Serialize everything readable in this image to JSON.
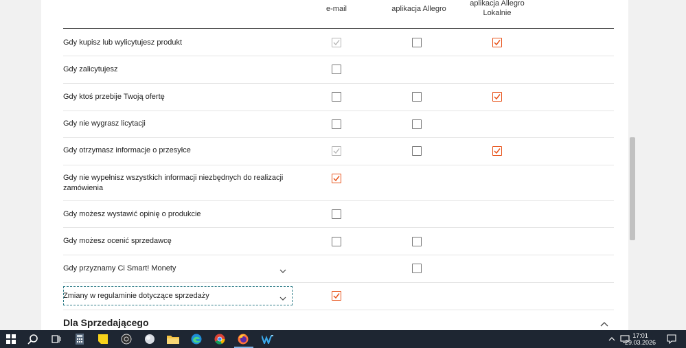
{
  "columns": {
    "email": "e-mail",
    "app": "aplikacja Allegro",
    "lokalnie": "aplikacja Allegro Lokalnie"
  },
  "rows": [
    {
      "label": "Gdy kupisz lub wylicytujesz produkt",
      "email": "checked-disabled",
      "app": "unchecked",
      "lokalnie": "checked"
    },
    {
      "label": "Gdy zalicytujesz",
      "email": "unchecked",
      "app": "",
      "lokalnie": ""
    },
    {
      "label": "Gdy ktoś przebije Twoją ofertę",
      "email": "unchecked",
      "app": "unchecked",
      "lokalnie": "checked"
    },
    {
      "label": "Gdy nie wygrasz licytacji",
      "email": "unchecked",
      "app": "unchecked",
      "lokalnie": ""
    },
    {
      "label": "Gdy otrzymasz informacje o przesyłce",
      "email": "checked-disabled",
      "app": "unchecked",
      "lokalnie": "checked"
    },
    {
      "label_line1": "Gdy nie wypełnisz wszystkich informacji niezbędnych do realizacji",
      "label_line2": "zamówienia",
      "email": "checked",
      "app": "",
      "lokalnie": ""
    },
    {
      "label": "Gdy możesz wystawić opinię o produkcie",
      "email": "unchecked",
      "app": "",
      "lokalnie": ""
    },
    {
      "label": "Gdy możesz ocenić sprzedawcę",
      "email": "unchecked",
      "app": "unchecked",
      "lokalnie": ""
    },
    {
      "label": "Gdy przyznamy Ci Smart! Monety",
      "email": "",
      "app": "unchecked",
      "lokalnie": "",
      "expandable": true
    },
    {
      "label": "Zmiany w regulaminie dotyczące sprzedaży",
      "email": "checked",
      "app": "",
      "lokalnie": "",
      "expandable": true,
      "focused": true
    }
  ],
  "section": {
    "title": "Dla Sprzedającego"
  },
  "colors": {
    "accent": "#e8531a",
    "taskbar": "#1e2632"
  },
  "taskbar": {
    "icons": [
      "windows-start-icon",
      "search-icon",
      "task-view-icon",
      "calculator-icon",
      "sticky-notes-icon",
      "media-icon",
      "generic-app-icon",
      "file-explorer-icon",
      "edge-icon",
      "chrome-icon",
      "firefox-icon",
      "app-w-icon"
    ],
    "time": "17:01",
    "date": "29.03.2026"
  }
}
